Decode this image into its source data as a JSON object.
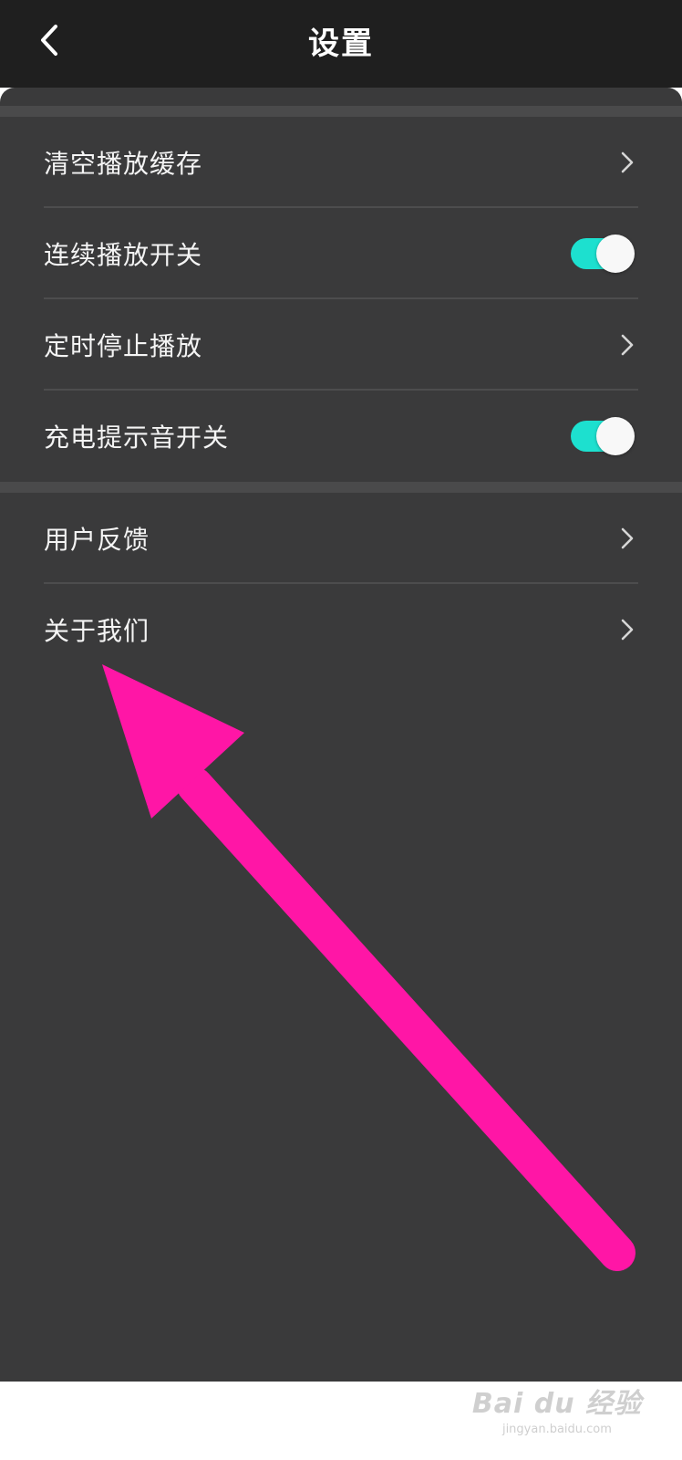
{
  "header": {
    "title": "设置"
  },
  "settings": {
    "group1": [
      {
        "label": "清空播放缓存",
        "control": "chevron"
      },
      {
        "label": "连续播放开关",
        "control": "toggle",
        "on": true
      },
      {
        "label": "定时停止播放",
        "control": "chevron"
      },
      {
        "label": "充电提示音开关",
        "control": "toggle",
        "on": true
      }
    ],
    "group2": [
      {
        "label": "用户反馈",
        "control": "chevron"
      },
      {
        "label": "关于我们",
        "control": "chevron"
      }
    ]
  },
  "colors": {
    "header_bg": "#1f1f1f",
    "panel_bg": "#3a3a3b",
    "toggle_on": "#1de0cf",
    "annotation_arrow": "#ff16a6"
  },
  "watermark": {
    "logo": "Bai du 经验",
    "url": "jingyan.baidu.com"
  }
}
